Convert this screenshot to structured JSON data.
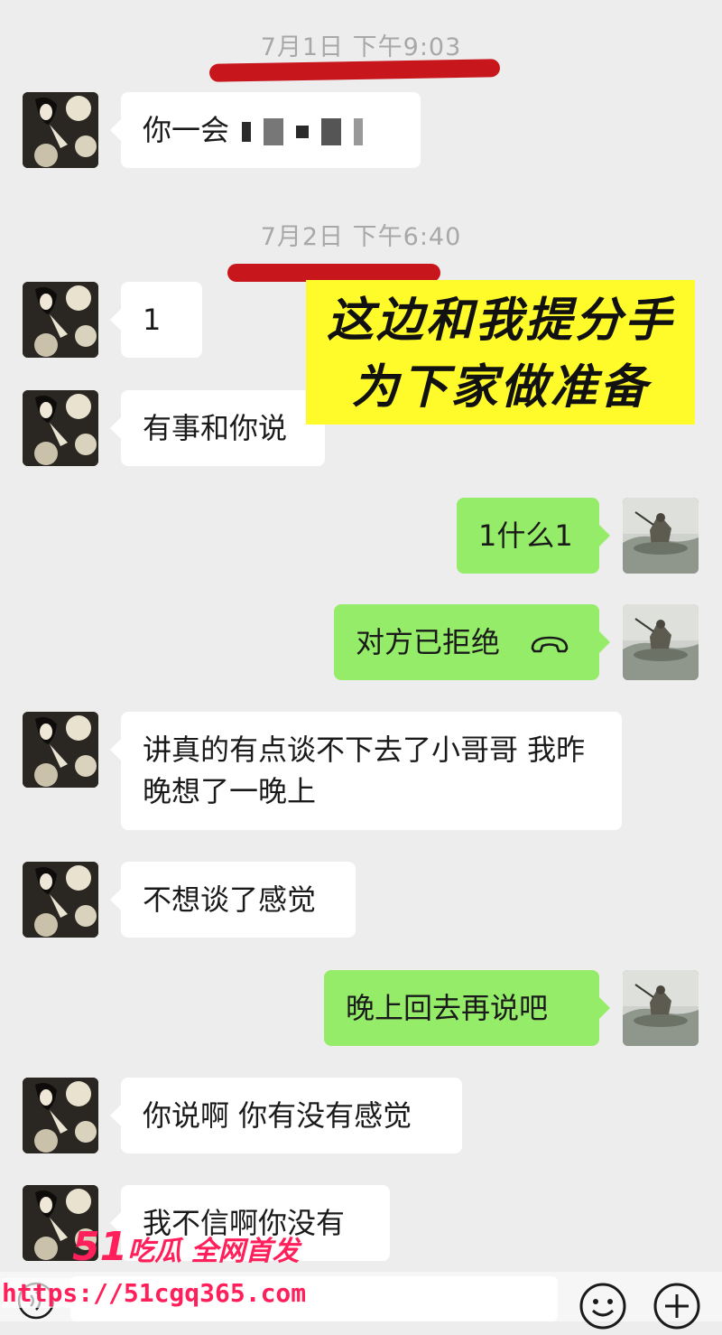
{
  "chat": {
    "timestamps": [
      "7月1日 下午9:03",
      "7月2日 下午6:40"
    ],
    "messages": [
      {
        "side": "in",
        "text": "你一会"
      },
      {
        "side": "in",
        "text": "1"
      },
      {
        "side": "in",
        "text": "有事和你说"
      },
      {
        "side": "out",
        "text": "1什么1"
      },
      {
        "side": "out",
        "text": "对方已拒绝",
        "icon": "call-declined-icon"
      },
      {
        "side": "in",
        "text": "讲真的有点谈不下去了小哥哥 我昨晚想了一晚上"
      },
      {
        "side": "in",
        "text": "不想谈了感觉"
      },
      {
        "side": "out",
        "text": "晚上回去再说吧"
      },
      {
        "side": "in",
        "text": "你说啊 你有没有感觉"
      },
      {
        "side": "in",
        "text": "我不信啊你没有"
      }
    ]
  },
  "sticker": {
    "line1": "这边和我提分手",
    "line2": "为下家做准备"
  },
  "watermark": {
    "number": "51",
    "tagline": "吃瓜 全网首发",
    "url": "https://51cgq365.com"
  },
  "colors": {
    "incoming_bubble": "#ffffff",
    "outgoing_bubble": "#95ec69",
    "underline": "#c8161d",
    "sticker_bg": "#fffb2a",
    "watermark": "#ff1f5a"
  },
  "icons": [
    "emoji-icon",
    "plus-icon",
    "voice-icon"
  ]
}
